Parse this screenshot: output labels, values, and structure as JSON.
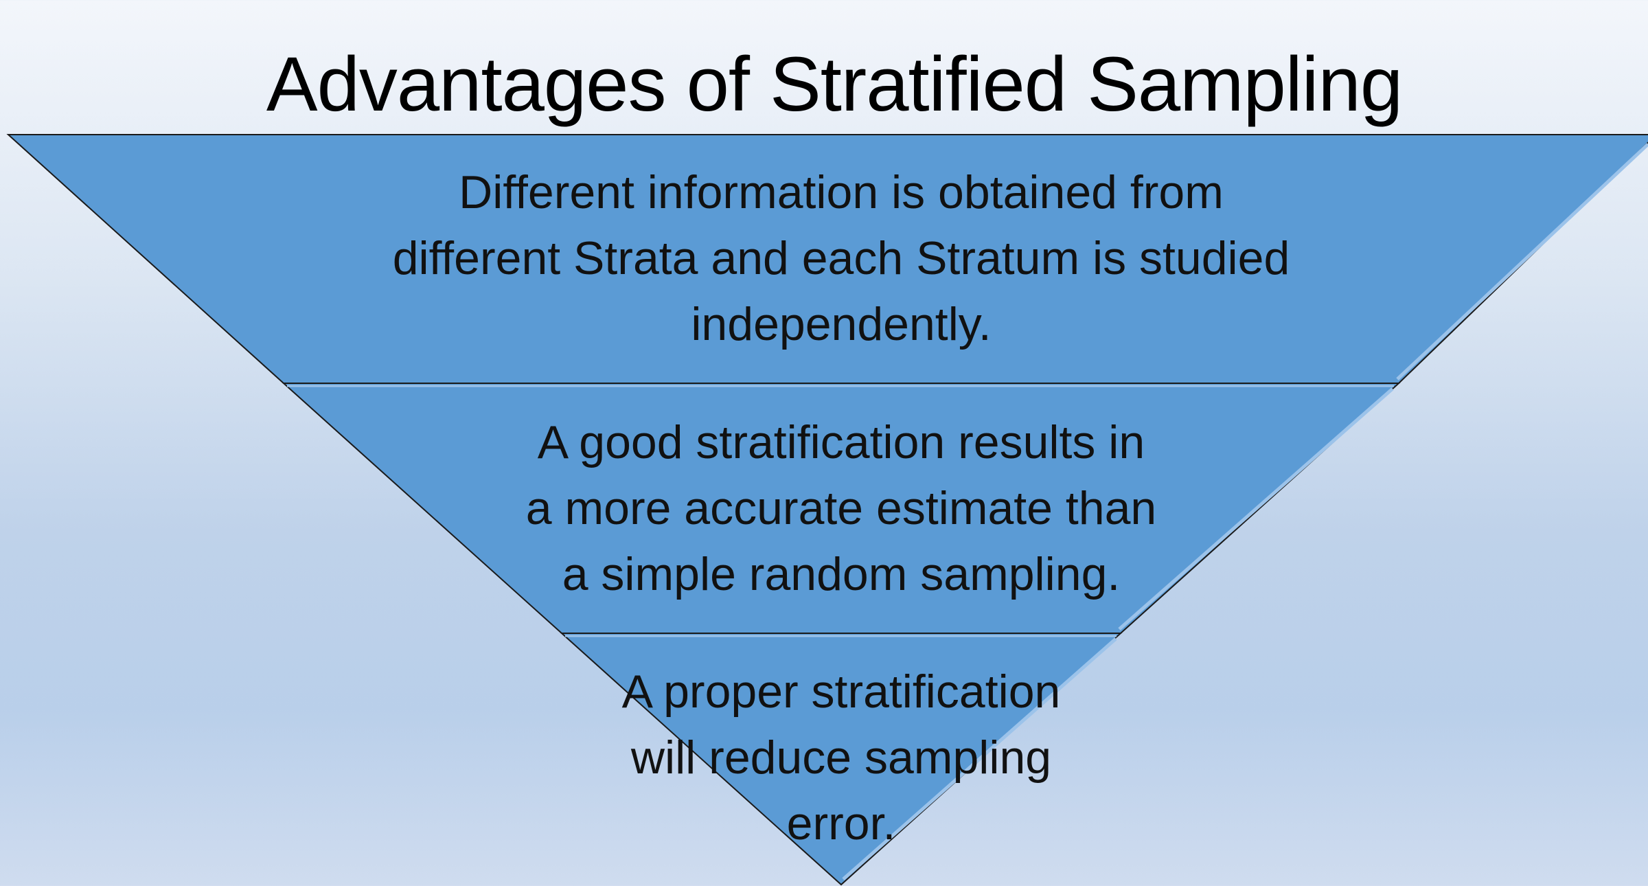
{
  "slide": {
    "title": "Advantages of Stratified Sampling"
  },
  "funnel": {
    "fill_color": "#5b9bd5",
    "edge_color": "#1a1a1a",
    "tiers": [
      {
        "lines": [
          "Different information is obtained from",
          "different Strata and each Stratum is studied",
          "independently."
        ]
      },
      {
        "lines": [
          "A good stratification results in",
          "a more accurate estimate than",
          "a simple random sampling."
        ]
      },
      {
        "lines": [
          "A proper stratification",
          "will reduce sampling",
          "error."
        ]
      }
    ]
  }
}
